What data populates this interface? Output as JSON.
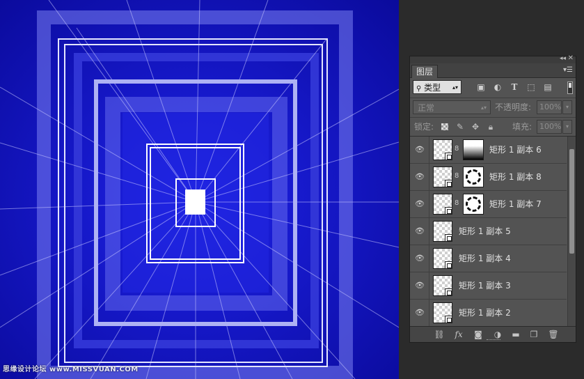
{
  "canvas": {
    "background_color": "#1111c8",
    "line_color": "#c8c8ff"
  },
  "panel": {
    "collapse_icon": "double-chevron-icon",
    "tab_label": "图层",
    "filter": {
      "kind_label": "类型",
      "icons": [
        "image-filter-icon",
        "adjustment-filter-icon",
        "type-filter-icon",
        "shape-filter-icon",
        "smart-object-filter-icon"
      ]
    },
    "blend": {
      "mode": "正常",
      "opacity_label": "不透明度:",
      "opacity_value": "100%"
    },
    "lock": {
      "label": "锁定:",
      "fill_label": "填充:",
      "fill_value": "100%"
    },
    "layers": [
      {
        "name": "矩形 1 副本 6",
        "mask": "gradient"
      },
      {
        "name": "矩形 1 副本 8",
        "mask": "holes"
      },
      {
        "name": "矩形 1 副本 7",
        "mask": "holes"
      },
      {
        "name": "矩形 1 副本 5",
        "mask": "none"
      },
      {
        "name": "矩形 1 副本 4",
        "mask": "none"
      },
      {
        "name": "矩形 1 副本 3",
        "mask": "none"
      },
      {
        "name": "矩形 1 副本 2",
        "mask": "none"
      }
    ],
    "bottom_icons": [
      "link-layers-icon",
      "fx-icon",
      "add-mask-icon",
      "adjustment-layer-icon",
      "new-group-icon",
      "new-layer-icon",
      "trash-icon"
    ]
  },
  "watermark": "思缘设计论坛 www.MISSVUAN.COM"
}
